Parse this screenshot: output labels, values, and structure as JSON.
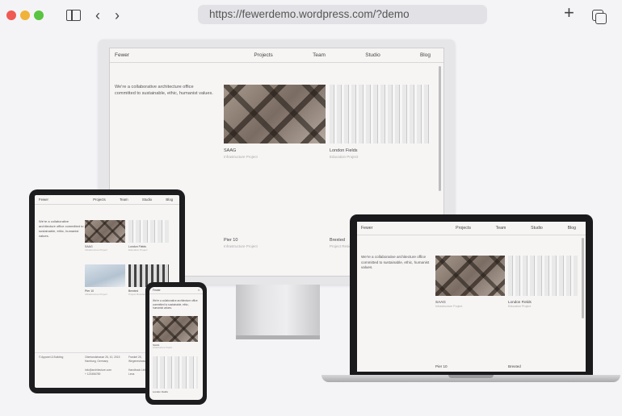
{
  "browser": {
    "url": "https://fewerdemo.wordpress.com/?demo",
    "icons": [
      "sidebar-icon",
      "back-icon",
      "forward-icon",
      "new-tab-icon",
      "tabs-overview-icon"
    ]
  },
  "site": {
    "brand": "Fewer",
    "nav": [
      "Projects",
      "Team",
      "Studio",
      "Blog"
    ],
    "intro": "We're a collaborative architecture office committed to sustainable, ethic, humanist values.",
    "projects": [
      {
        "title": "SAAG",
        "tags": "Infrastructure  Project"
      },
      {
        "title": "London Fields",
        "tags": "Education  Project"
      },
      {
        "title": "Pier 10",
        "tags": "Infrastructure  Project"
      },
      {
        "title": "Brexted",
        "tags": "Project  Residential"
      }
    ],
    "footer": {
      "copyright": "© Apparel & Building",
      "address": "Oberlandstrasse 26, 10, 2015 Hamburg, Germany",
      "address2": "Frankel 26, Wegenestrasse",
      "email": "info@architecture.com",
      "phone": "+ 123456789",
      "other": "Handbook Linkedin Lena"
    }
  },
  "colors": {
    "page": "#f4f4f7",
    "site_bg": "#f7f4f4",
    "device": "#1d1d1f",
    "url_bar": "#e2e2e6"
  }
}
